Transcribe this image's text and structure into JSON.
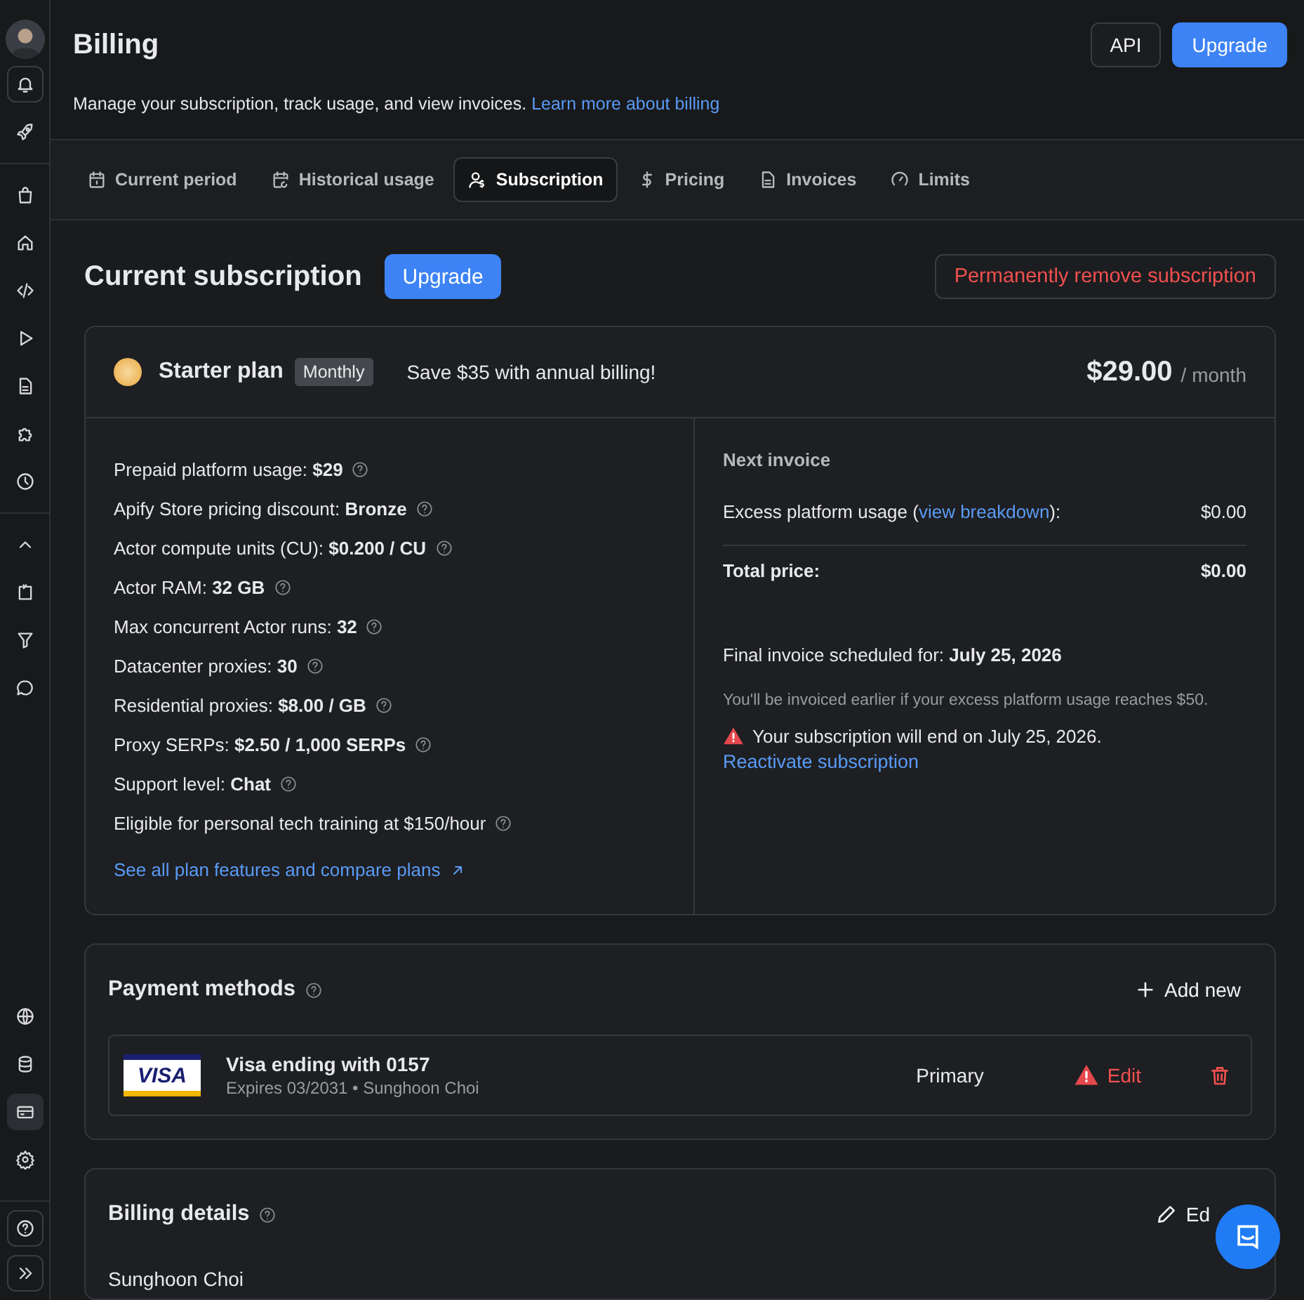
{
  "sidebar": {
    "items": [
      {
        "selected": false
      },
      {
        "selected": false
      },
      {
        "selected": false
      },
      {
        "selected": false
      },
      {
        "selected": false
      },
      {
        "selected": false
      },
      {
        "selected": false
      },
      {
        "selected": false
      },
      {
        "selected": false
      },
      {
        "selected": false
      },
      {
        "selected": false
      },
      {
        "selected": false
      },
      {
        "selected": false
      },
      {
        "selected": false
      },
      {
        "selected": false
      },
      {
        "selected": true
      },
      {
        "selected": false
      },
      {
        "selected": false
      },
      {
        "selected": false
      }
    ]
  },
  "header": {
    "title": "Billing",
    "subtitle": "Manage your subscription, track usage, and view invoices.",
    "learn_link": "Learn more about billing",
    "buttons": [
      {
        "label": "API",
        "kind": "secondary"
      },
      {
        "label": "Upgrade",
        "kind": "primary"
      }
    ]
  },
  "tabs": [
    {
      "label": "Current period",
      "selected": false
    },
    {
      "label": "Historical usage",
      "selected": false
    },
    {
      "label": "Subscription",
      "selected": true
    },
    {
      "label": "Pricing",
      "selected": false
    },
    {
      "label": "Invoices",
      "selected": false
    },
    {
      "label": "Limits",
      "selected": false
    }
  ],
  "subscription": {
    "title": "Current subscription",
    "upgrade_button": "Upgrade",
    "remove_button": "Permanently remove subscription",
    "plan": {
      "name": "Starter plan",
      "cycle": "Monthly",
      "promo": "Save $35 with annual billing!",
      "price": "$29.00",
      "period": "/ month"
    },
    "features": [
      "Prepaid platform usage: **$29**",
      "Apify Store pricing discount: **Bronze**",
      "Actor compute units (CU): **$0.200 / CU**",
      "Actor RAM: **32 GB**",
      "Max concurrent Actor runs: **32**",
      "Datacenter proxies: **30**",
      "Residential proxies: **$8.00 / GB**",
      "Proxy SERPs: **$2.50 / 1,000 SERPs**",
      "Support level: **Chat**",
      "Eligible for personal tech training at $150/hour"
    ],
    "compare_link": "See all plan features and compare plans",
    "next_invoice": {
      "title": "Next invoice",
      "excess_label": "Excess platform usage (",
      "breakdown_link": "view breakdown",
      "excess_suffix": "):",
      "excess_value": "$0.00",
      "total_label": "Total price:",
      "total_value": "$0.00",
      "final_label": "Final invoice scheduled for: **July 25, 2026**",
      "note": "You'll be invoiced earlier if your excess platform usage reaches $50.",
      "warning": "Your subscription will end on July 25, 2026.",
      "reactivate_link": "Reactivate subscription"
    }
  },
  "payment_methods": {
    "title": "Payment methods",
    "add_button": "Add new",
    "cards": [
      {
        "brand": "VISA",
        "name": "Visa ending with 0157",
        "details": "Expires 03/2031 • Sunghoon Choi",
        "status": "Primary",
        "edit": "Edit",
        "edit_warning": true
      }
    ]
  },
  "billing_details": {
    "title": "Billing details",
    "edit_button": "Ed",
    "name": "Sunghoon Choi"
  }
}
